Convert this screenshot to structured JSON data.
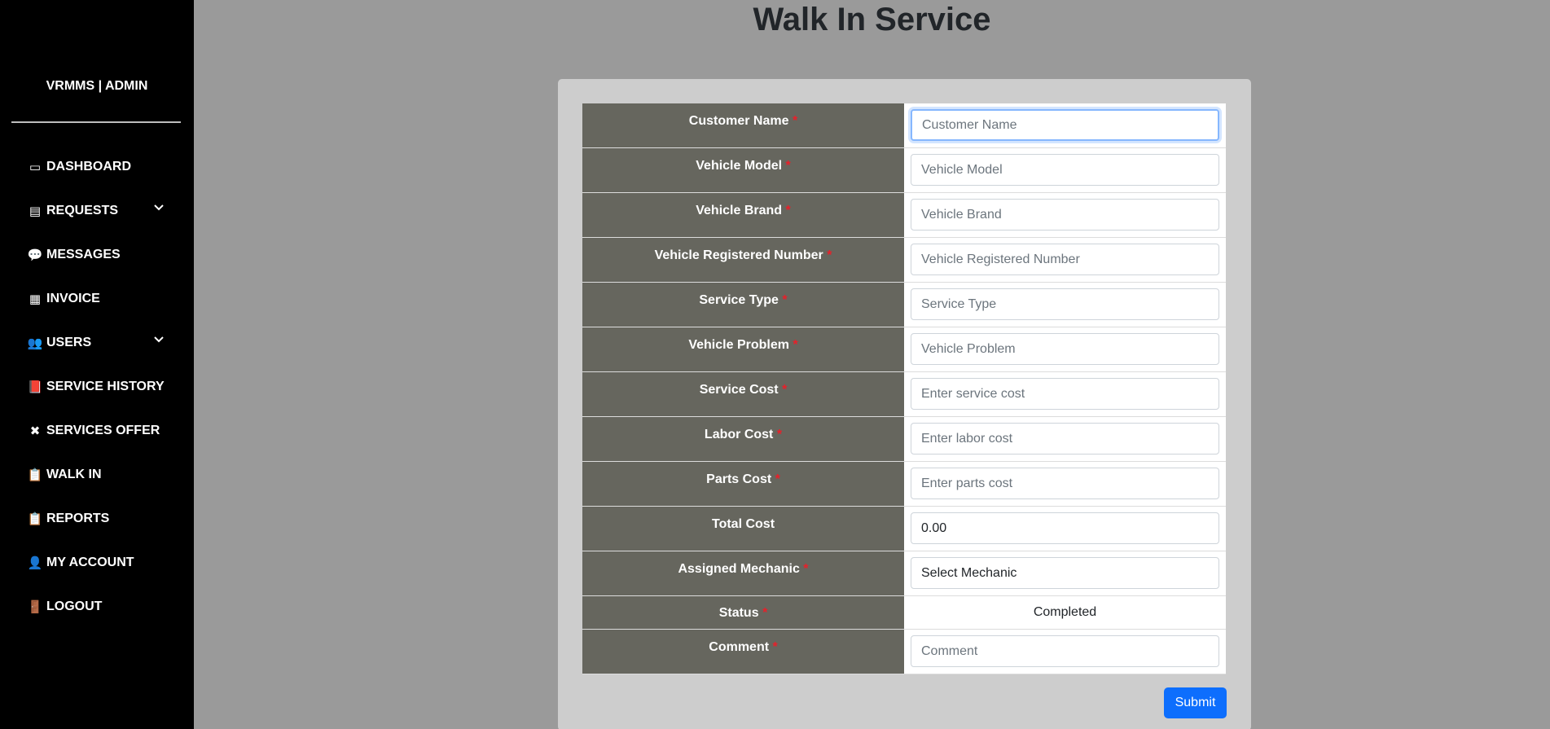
{
  "sidebar": {
    "brand": "VRMMS | ADMIN",
    "items": [
      {
        "label": "DASHBOARD",
        "icon": "dashboard-icon",
        "glyph": "▭"
      },
      {
        "label": "REQUESTS",
        "icon": "file-icon",
        "glyph": "▤",
        "expandable": true
      },
      {
        "label": "MESSAGES",
        "icon": "chat-icon",
        "glyph": "💬"
      },
      {
        "label": "INVOICE",
        "icon": "receipt-icon",
        "glyph": "▦"
      },
      {
        "label": "USERS",
        "icon": "users-icon",
        "glyph": "👥",
        "expandable": true
      },
      {
        "label": "SERVICE HISTORY",
        "icon": "book-icon",
        "glyph": "📕"
      },
      {
        "label": "SERVICES OFFER",
        "icon": "tools-icon",
        "glyph": "✖"
      },
      {
        "label": "WALK IN",
        "icon": "clipboard-icon",
        "glyph": "📋"
      },
      {
        "label": "REPORTS",
        "icon": "clipboard-check-icon",
        "glyph": "📋"
      },
      {
        "label": "MY ACCOUNT",
        "icon": "user-icon",
        "glyph": "👤"
      },
      {
        "label": "LOGOUT",
        "icon": "door-icon",
        "glyph": "🚪"
      }
    ]
  },
  "page": {
    "title": "Walk In Service"
  },
  "form": {
    "customer_name": {
      "label": "Customer Name",
      "placeholder": "Customer Name",
      "required": "*"
    },
    "vehicle_model": {
      "label": "Vehicle Model",
      "placeholder": "Vehicle Model",
      "required": "*"
    },
    "vehicle_brand": {
      "label": "Vehicle Brand",
      "placeholder": "Vehicle Brand",
      "required": "*"
    },
    "vehicle_reg": {
      "label": "Vehicle Registered Number",
      "placeholder": "Vehicle Registered Number",
      "required": "*"
    },
    "service_type": {
      "label": "Service Type",
      "placeholder": "Service Type",
      "required": "*"
    },
    "vehicle_problem": {
      "label": "Vehicle Problem",
      "placeholder": "Vehicle Problem",
      "required": "*"
    },
    "service_cost": {
      "label": "Service Cost",
      "placeholder": "Enter service cost",
      "required": "*"
    },
    "labor_cost": {
      "label": "Labor Cost",
      "placeholder": "Enter labor cost",
      "required": "*"
    },
    "parts_cost": {
      "label": "Parts Cost",
      "placeholder": "Enter parts cost",
      "required": "*"
    },
    "total_cost": {
      "label": "Total Cost",
      "value": "0.00"
    },
    "mechanic": {
      "label": "Assigned Mechanic",
      "value": "Select Mechanic",
      "required": "*"
    },
    "status": {
      "label": "Status",
      "value": "Completed",
      "required": "*"
    },
    "comment": {
      "label": "Comment",
      "placeholder": "Comment",
      "required": "*"
    },
    "submit_label": "Submit"
  },
  "colors": {
    "sidebar_bg": "#000000",
    "page_bg": "#9a9a9a",
    "card_bg": "#cdcdcd",
    "label_bg": "#66665e",
    "required": "#e8202a",
    "primary": "#0d6efd"
  }
}
